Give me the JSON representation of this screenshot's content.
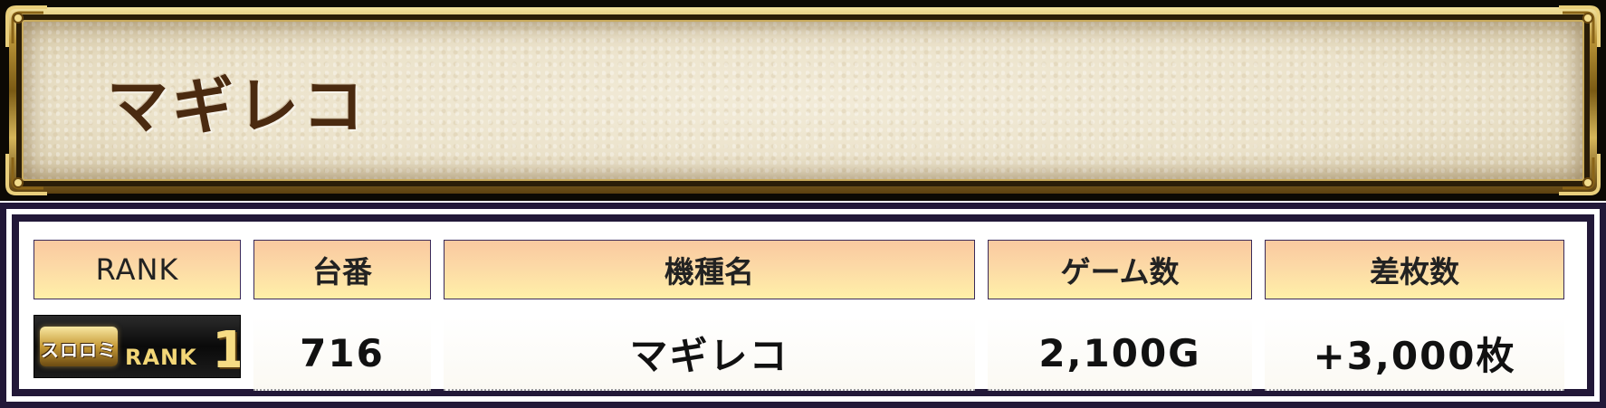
{
  "banner": {
    "title": "マギレコ"
  },
  "table": {
    "headers": {
      "rank": "RANK",
      "machine_number": "台番",
      "model_name": "機種名",
      "games": "ゲーム数",
      "difference": "差枚数"
    },
    "rows": [
      {
        "rank_badge": {
          "logo_text": "スロロミ",
          "word": "RANK",
          "number": "1"
        },
        "machine_number": "716",
        "model_name": "マギレコ",
        "games": "2,100G",
        "difference": "+3,000枚"
      }
    ]
  },
  "colors": {
    "frame": "#221838",
    "header_gradient_top": "#fac9a0",
    "header_gradient_bottom": "#fff0a8",
    "title_text": "#4a2a10",
    "banner_gold": "#b89236"
  }
}
